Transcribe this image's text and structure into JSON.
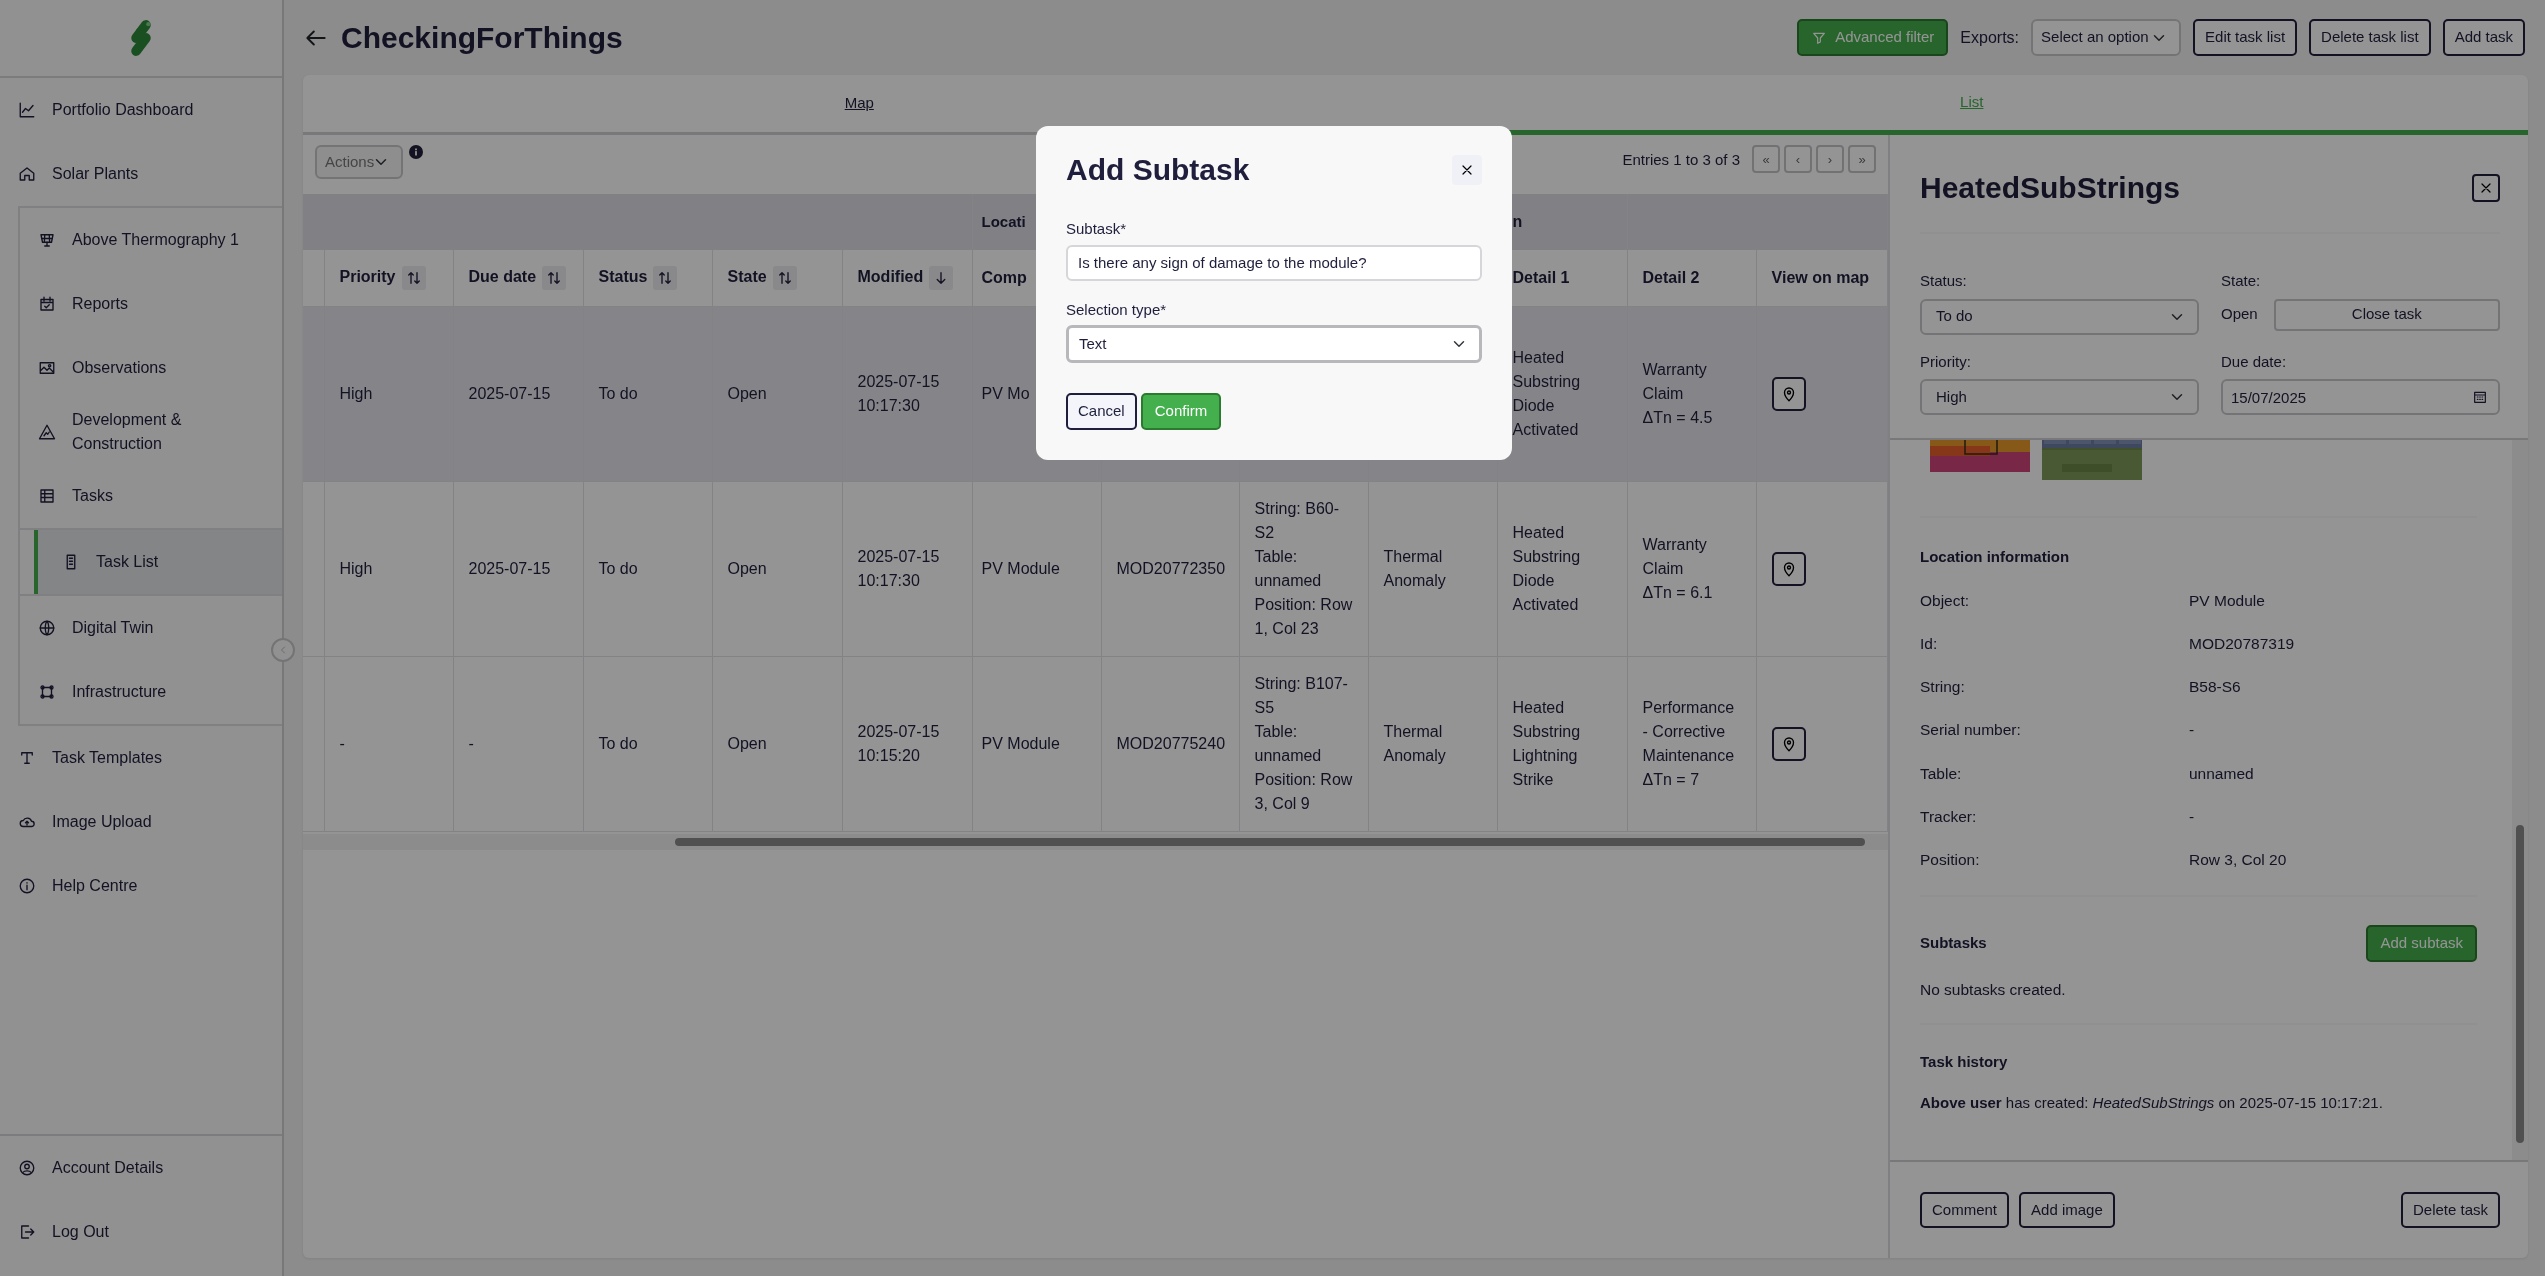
{
  "app": {
    "title": "CheckingForThings"
  },
  "sidebar": {
    "items": [
      {
        "label": "Portfolio Dashboard",
        "selected": false
      },
      {
        "label": "Solar Plants",
        "selected": false,
        "children": [
          {
            "label": "Above Thermography 1",
            "selected": false
          },
          {
            "label": "Reports",
            "selected": false
          },
          {
            "label": "Observations",
            "selected": false
          },
          {
            "label": "Development & Construction",
            "selected": false
          },
          {
            "label": "Tasks",
            "selected": false,
            "children": [
              {
                "label": "Task List",
                "selected": true
              }
            ]
          },
          {
            "label": "Digital Twin",
            "selected": false
          },
          {
            "label": "Infrastructure",
            "selected": false
          }
        ]
      },
      {
        "label": "Task Templates",
        "selected": false
      },
      {
        "label": "Image Upload",
        "selected": false
      },
      {
        "label": "Help Centre",
        "selected": false
      }
    ],
    "bottom_items": [
      {
        "label": "Account Details"
      },
      {
        "label": "Log Out"
      }
    ]
  },
  "toolbar": {
    "advanced_filter": "Advanced filter",
    "exports_label": "Exports:",
    "exports_select": "Select an option",
    "buttons": [
      "Edit task list",
      "Delete task list",
      "Add task"
    ]
  },
  "tabs": [
    {
      "label": "Map",
      "selected": false
    },
    {
      "label": "List",
      "selected": true
    }
  ],
  "table": {
    "actions": "Actions",
    "entries": "Entries 1 to 3 of 3",
    "pager": [
      "«",
      "‹",
      "›",
      "»"
    ],
    "groups": [
      "Locati",
      "n"
    ],
    "columns": [
      {
        "label": "Priority",
        "kind": "sortable"
      },
      {
        "label": "Due date",
        "kind": "sortable"
      },
      {
        "label": "Status",
        "kind": "sortable"
      },
      {
        "label": "State",
        "kind": "sortable"
      },
      {
        "label": "Modified",
        "kind": "sorted"
      },
      {
        "label": "Comp",
        "kind": "plain"
      },
      {
        "kind": "plain"
      },
      {
        "kind": "plain"
      },
      {
        "kind": "plain"
      },
      {
        "label": "Detail 1",
        "kind": "plain"
      },
      {
        "label": "Detail 2",
        "kind": "plain"
      },
      {
        "label": "View on map",
        "kind": "plain"
      }
    ],
    "rows": [
      {
        "selected": true,
        "cells": [
          "High",
          "2025-07-15",
          "To do",
          "Open",
          "2025-07-15 10:17:30",
          "PV Mo",
          null,
          null,
          null,
          "Heated Substring Diode Activated",
          "Warranty Claim\nΔTn = 4.5"
        ]
      },
      {
        "selected": false,
        "cells": [
          "High",
          "2025-07-15",
          "To do",
          "Open",
          "2025-07-15 10:17:30",
          "PV Module",
          "MOD20772350",
          "String: B60-S2\nTable: unnamed\nPosition: Row 1, Col 23",
          "Thermal Anomaly",
          "Heated Substring Diode Activated",
          "Warranty Claim\nΔTn = 6.1"
        ]
      },
      {
        "selected": false,
        "cells": [
          "-",
          "-",
          "To do",
          "Open",
          "2025-07-15 10:15:20",
          "PV Module",
          "MOD20775240",
          "String: B107-S5\nTable: unnamed\nPosition: Row 3, Col 9",
          "Thermal Anomaly",
          "Heated Substring Lightning Strike",
          "Performance - Corrective Maintenance\nΔTn = 7"
        ]
      }
    ]
  },
  "detail": {
    "title": "HeatedSubStrings",
    "status_label": "Status:",
    "status": "To do",
    "state_label": "State:",
    "state": "Open",
    "close_task": "Close task",
    "priority_label": "Priority:",
    "priority": "High",
    "due_label": "Due date:",
    "due": "15/07/2025",
    "images": [
      {
        "kind": "picture"
      },
      {
        "kind": "picture"
      }
    ],
    "location_title": "Location information",
    "location": [
      {
        "label": "Object:",
        "value": "PV Module"
      },
      {
        "label": "Id:",
        "value": "MOD20787319"
      },
      {
        "label": "String:",
        "value": "B58-S6"
      },
      {
        "label": "Serial number:",
        "value": "-"
      },
      {
        "label": "Table:",
        "value": "unnamed"
      },
      {
        "label": "Tracker:",
        "value": "-"
      },
      {
        "label": "Position:",
        "value": "Row 3, Col 20"
      }
    ],
    "subtasks_title": "Subtasks",
    "add_subtask": "Add subtask",
    "subtasks_empty": "No subtasks created.",
    "history_title": "Task history",
    "history": [
      "**Above user** has created: *HeatedSubStrings* on 2025-07-15 10:17:21."
    ],
    "footer_buttons": [
      "Comment",
      "Add image"
    ],
    "delete": "Delete task"
  },
  "modal": {
    "title": "Add Subtask",
    "fields": [
      {
        "label": "Subtask*",
        "kind": "text",
        "value": "Is there any sign of damage to the module?"
      },
      {
        "label": "Selection type*",
        "kind": "select",
        "value": "Text"
      }
    ],
    "cancel": "Cancel",
    "confirm": "Confirm"
  }
}
